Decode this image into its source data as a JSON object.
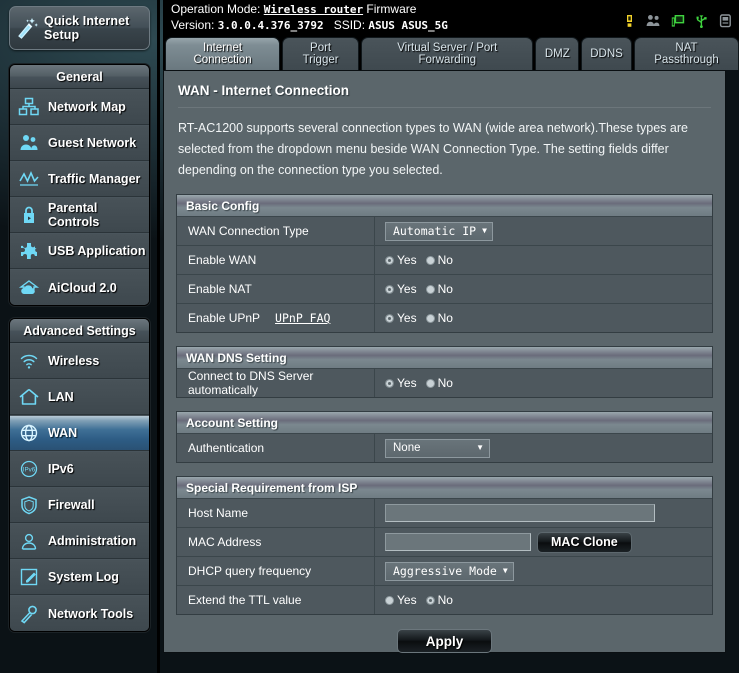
{
  "header": {
    "operation_mode_label": "Operation Mode:",
    "operation_mode_value": "Wireless router",
    "firmware_label": "Firmware",
    "version_label": "Version:",
    "version_value": "3.0.0.4.376_3792",
    "ssid_label": "SSID:",
    "ssid_value": "ASUS ASUS_5G",
    "icons": [
      {
        "name": "alert-icon",
        "color": "#f2d22a"
      },
      {
        "name": "guest-network-icon",
        "color": "#8d9499"
      },
      {
        "name": "client-monitor-icon",
        "color": "#3fd23f"
      },
      {
        "name": "usb-icon",
        "color": "#3fd23f"
      },
      {
        "name": "printer-icon",
        "color": "#8d9499"
      }
    ]
  },
  "sidebar": {
    "quick_setup": "Quick Internet Setup",
    "general_title": "General",
    "general_items": [
      {
        "label": "Network Map",
        "icon": "network-map-icon"
      },
      {
        "label": "Guest Network",
        "icon": "guest-network-icon"
      },
      {
        "label": "Traffic Manager",
        "icon": "traffic-manager-icon"
      },
      {
        "label": "Parental Controls",
        "icon": "parental-controls-lock-icon"
      },
      {
        "label": "USB Application",
        "icon": "usb-application-puzzle-icon"
      },
      {
        "label": "AiCloud 2.0",
        "icon": "aicloud-icon"
      }
    ],
    "advanced_title": "Advanced Settings",
    "advanced_items": [
      {
        "label": "Wireless",
        "icon": "wireless-signal-icon",
        "active": false
      },
      {
        "label": "LAN",
        "icon": "lan-home-icon",
        "active": false
      },
      {
        "label": "WAN",
        "icon": "wan-globe-icon",
        "active": true
      },
      {
        "label": "IPv6",
        "icon": "ipv6-globe-icon",
        "active": false
      },
      {
        "label": "Firewall",
        "icon": "firewall-shield-icon",
        "active": false
      },
      {
        "label": "Administration",
        "icon": "administration-user-icon",
        "active": false
      },
      {
        "label": "System Log",
        "icon": "system-log-icon",
        "active": false
      },
      {
        "label": "Network Tools",
        "icon": "network-tools-wrench-icon",
        "active": false
      }
    ]
  },
  "tabs": [
    {
      "label": "Internet Connection",
      "active": true
    },
    {
      "label": "Port Trigger",
      "active": false
    },
    {
      "label": "Virtual Server / Port Forwarding",
      "active": false
    },
    {
      "label": "DMZ",
      "active": false
    },
    {
      "label": "DDNS",
      "active": false
    },
    {
      "label": "NAT Passthrough",
      "active": false
    }
  ],
  "main": {
    "title": "WAN - Internet Connection",
    "description": "RT-AC1200 supports several connection types to WAN (wide area network).These types are selected from the dropdown menu beside WAN Connection Type. The setting fields differ depending on the connection type you selected.",
    "basic_config": {
      "title": "Basic Config",
      "wan_connection_type_label": "WAN Connection Type",
      "wan_connection_type_value": "Automatic IP",
      "enable_wan_label": "Enable WAN",
      "enable_wan_value": "Yes",
      "enable_nat_label": "Enable NAT",
      "enable_nat_value": "Yes",
      "enable_upnp_label": "Enable UPnP",
      "enable_upnp_faq": "UPnP FAQ",
      "enable_upnp_value": "Yes",
      "yes_label": "Yes",
      "no_label": "No"
    },
    "wan_dns": {
      "title": "WAN DNS Setting",
      "connect_dns_label": "Connect to DNS Server automatically",
      "connect_dns_value": "Yes"
    },
    "account": {
      "title": "Account Setting",
      "authentication_label": "Authentication",
      "authentication_value": "None"
    },
    "isp": {
      "title": "Special Requirement from ISP",
      "host_name_label": "Host Name",
      "host_name_value": "",
      "mac_address_label": "MAC Address",
      "mac_address_value": "",
      "mac_clone_button": "MAC Clone",
      "dhcp_query_label": "DHCP query frequency",
      "dhcp_query_value": "Aggressive Mode",
      "extend_ttl_label": "Extend the TTL value",
      "extend_ttl_value": "No"
    },
    "apply_button": "Apply"
  },
  "colors": {
    "panel": "#5b666b",
    "row": "#4e585e",
    "accent_active_nav": "#2d5c84",
    "icon_cyan": "#6fd8f5"
  }
}
